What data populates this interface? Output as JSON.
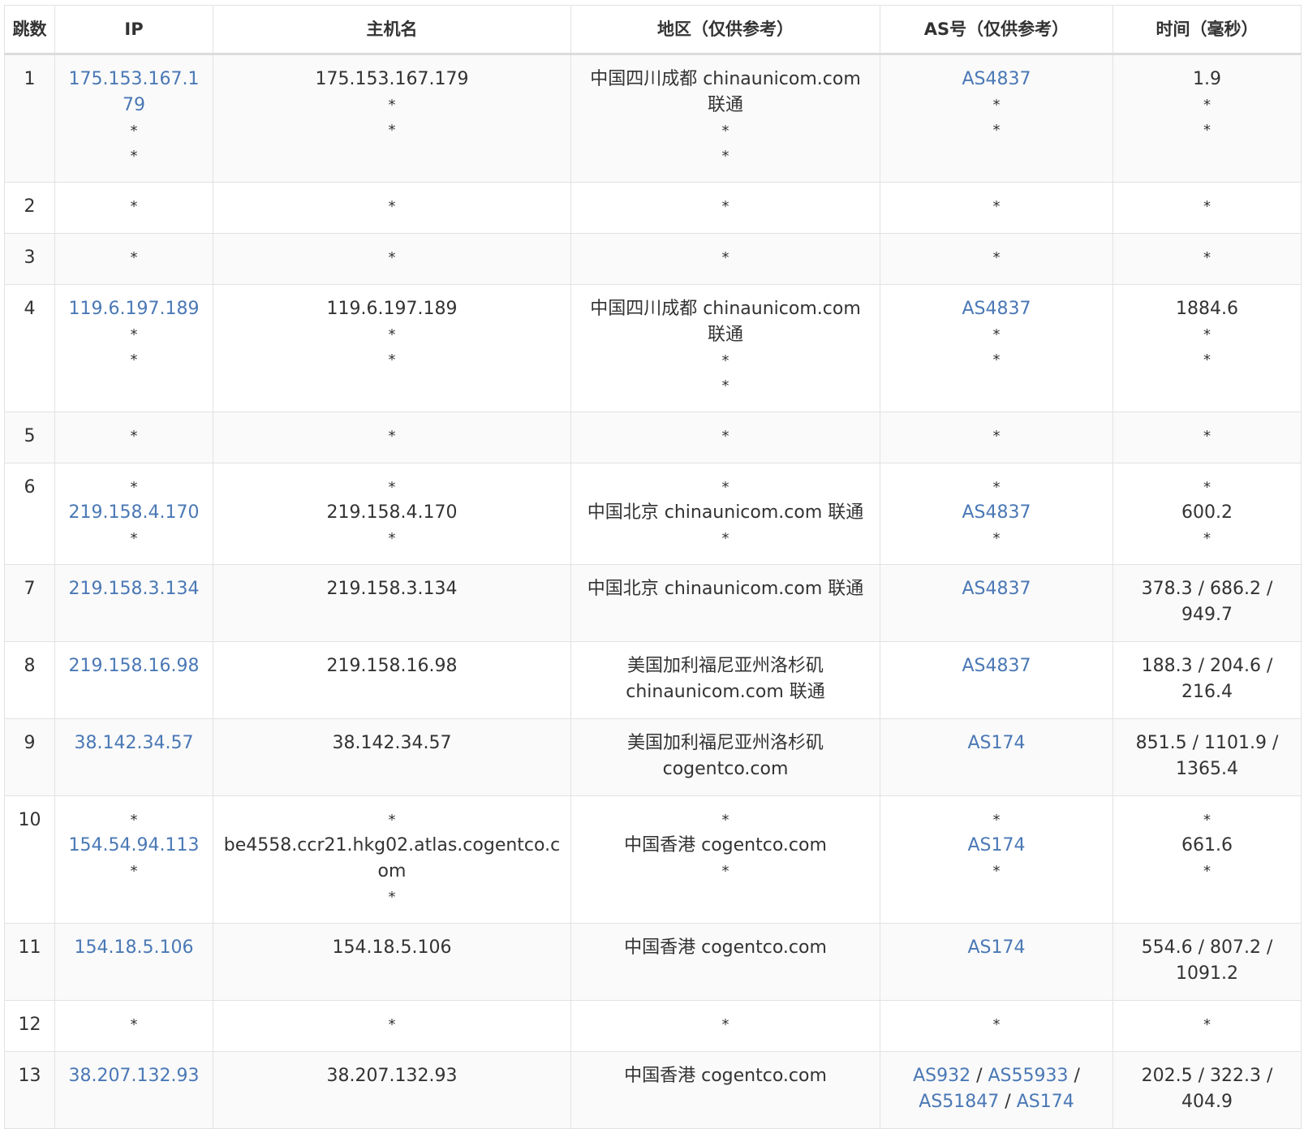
{
  "colors": {
    "link": "#4a78b5",
    "text": "#333333",
    "border": "#e2e2e2",
    "stripe": "#fafafa"
  },
  "headers": [
    "跳数",
    "IP",
    "主机名",
    "地区（仅供参考）",
    "AS号（仅供参考）",
    "时间（毫秒）"
  ],
  "rows": [
    {
      "hop": "1",
      "ip": [
        "175.153.167.179",
        "*",
        "*"
      ],
      "host": [
        "175.153.167.179",
        "*",
        "*"
      ],
      "region": [
        "中国四川成都 chinaunicom.com 联通",
        "*",
        "*"
      ],
      "as": [
        [
          "AS4837"
        ],
        [
          "*"
        ],
        [
          "*"
        ]
      ],
      "time": [
        "1.9",
        "*",
        "*"
      ]
    },
    {
      "hop": "2",
      "ip": [
        "*"
      ],
      "host": [
        "*"
      ],
      "region": [
        "*"
      ],
      "as": [
        [
          "*"
        ]
      ],
      "time": [
        "*"
      ]
    },
    {
      "hop": "3",
      "ip": [
        "*"
      ],
      "host": [
        "*"
      ],
      "region": [
        "*"
      ],
      "as": [
        [
          "*"
        ]
      ],
      "time": [
        "*"
      ]
    },
    {
      "hop": "4",
      "ip": [
        "119.6.197.189",
        "*",
        "*"
      ],
      "host": [
        "119.6.197.189",
        "*",
        "*"
      ],
      "region": [
        "中国四川成都 chinaunicom.com 联通",
        "*",
        "*"
      ],
      "as": [
        [
          "AS4837"
        ],
        [
          "*"
        ],
        [
          "*"
        ]
      ],
      "time": [
        "1884.6",
        "*",
        "*"
      ]
    },
    {
      "hop": "5",
      "ip": [
        "*"
      ],
      "host": [
        "*"
      ],
      "region": [
        "*"
      ],
      "as": [
        [
          "*"
        ]
      ],
      "time": [
        "*"
      ]
    },
    {
      "hop": "6",
      "ip": [
        "*",
        "219.158.4.170",
        "*"
      ],
      "host": [
        "*",
        "219.158.4.170",
        "*"
      ],
      "region": [
        "*",
        "中国北京 chinaunicom.com 联通",
        "*"
      ],
      "as": [
        [
          "*"
        ],
        [
          "AS4837"
        ],
        [
          "*"
        ]
      ],
      "time": [
        "*",
        "600.2",
        "*"
      ]
    },
    {
      "hop": "7",
      "ip": [
        "219.158.3.134"
      ],
      "host": [
        "219.158.3.134"
      ],
      "region": [
        "中国北京 chinaunicom.com 联通"
      ],
      "as": [
        [
          "AS4837"
        ]
      ],
      "time": [
        "378.3 / 686.2 / 949.7"
      ]
    },
    {
      "hop": "8",
      "ip": [
        "219.158.16.98"
      ],
      "host": [
        "219.158.16.98"
      ],
      "region": [
        "美国加利福尼亚州洛杉矶 chinaunicom.com 联通"
      ],
      "as": [
        [
          "AS4837"
        ]
      ],
      "time": [
        "188.3 / 204.6 / 216.4"
      ]
    },
    {
      "hop": "9",
      "ip": [
        "38.142.34.57"
      ],
      "host": [
        "38.142.34.57"
      ],
      "region": [
        "美国加利福尼亚州洛杉矶 cogentco.com"
      ],
      "as": [
        [
          "AS174"
        ]
      ],
      "time": [
        "851.5 / 1101.9 / 1365.4"
      ]
    },
    {
      "hop": "10",
      "ip": [
        "*",
        "154.54.94.113",
        "*"
      ],
      "host": [
        "*",
        "be4558.ccr21.hkg02.atlas.cogentco.com",
        "*"
      ],
      "region": [
        "*",
        "中国香港 cogentco.com",
        "*"
      ],
      "as": [
        [
          "*"
        ],
        [
          "AS174"
        ],
        [
          "*"
        ]
      ],
      "time": [
        "*",
        "661.6",
        "*"
      ]
    },
    {
      "hop": "11",
      "ip": [
        "154.18.5.106"
      ],
      "host": [
        "154.18.5.106"
      ],
      "region": [
        "中国香港 cogentco.com"
      ],
      "as": [
        [
          "AS174"
        ]
      ],
      "time": [
        "554.6 / 807.2 / 1091.2"
      ]
    },
    {
      "hop": "12",
      "ip": [
        "*"
      ],
      "host": [
        "*"
      ],
      "region": [
        "*"
      ],
      "as": [
        [
          "*"
        ]
      ],
      "time": [
        "*"
      ]
    },
    {
      "hop": "13",
      "ip": [
        "38.207.132.93"
      ],
      "host": [
        "38.207.132.93"
      ],
      "region": [
        "中国香港 cogentco.com"
      ],
      "as": [
        [
          "AS932",
          "AS55933",
          "AS51847",
          "AS174"
        ]
      ],
      "time": [
        "202.5 / 322.3 / 404.9"
      ]
    }
  ]
}
